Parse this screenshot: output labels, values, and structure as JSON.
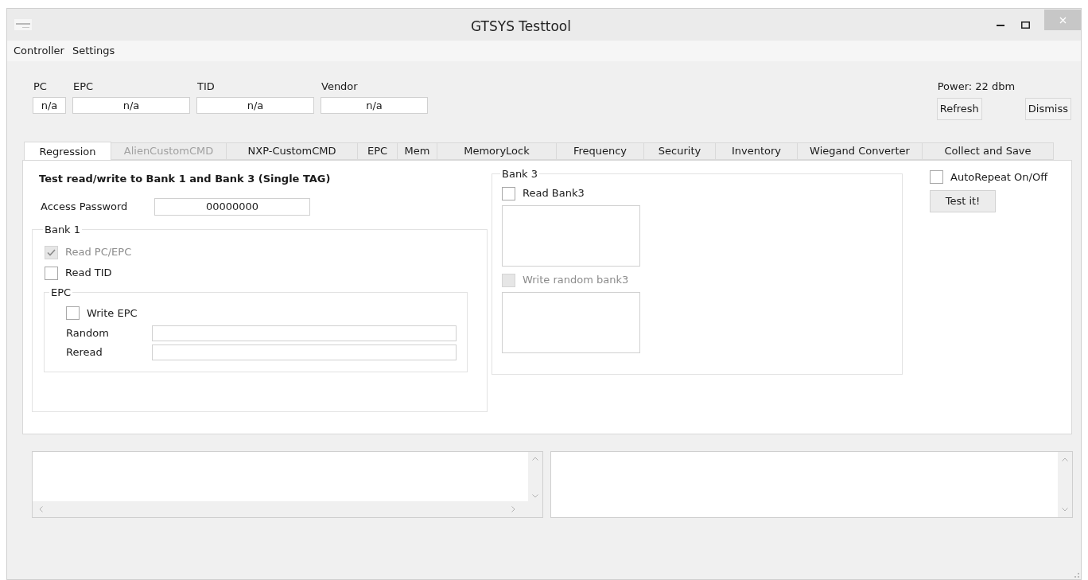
{
  "window": {
    "title": "GTSYS Testtool"
  },
  "menu": [
    "Controller",
    "Settings"
  ],
  "tag_fields": [
    {
      "label": "PC",
      "value": "n/a"
    },
    {
      "label": "EPC",
      "value": "n/a"
    },
    {
      "label": "TID",
      "value": "n/a"
    },
    {
      "label": "Vendor",
      "value": "n/a"
    }
  ],
  "power": "Power: 22 dbm",
  "header_buttons": [
    "Refresh",
    "Dismiss"
  ],
  "tabs": [
    {
      "label": "Regression",
      "selected": true,
      "disabled": false
    },
    {
      "label": "AlienCustomCMD",
      "selected": false,
      "disabled": true
    },
    {
      "label": "NXP-CustomCMD",
      "selected": false,
      "disabled": false
    },
    {
      "label": "EPC",
      "selected": false,
      "disabled": false
    },
    {
      "label": "Mem",
      "selected": false,
      "disabled": false
    },
    {
      "label": "MemoryLock",
      "selected": false,
      "disabled": false
    },
    {
      "label": "Frequency",
      "selected": false,
      "disabled": false
    },
    {
      "label": "Security",
      "selected": false,
      "disabled": false
    },
    {
      "label": "Inventory",
      "selected": false,
      "disabled": false
    },
    {
      "label": "Wiegand Converter",
      "selected": false,
      "disabled": false
    },
    {
      "label": "Collect and Save",
      "selected": false,
      "disabled": false
    }
  ],
  "regression": {
    "heading": "Test read/write to Bank 1 and  Bank 3 (Single TAG)",
    "access_password": {
      "label": "Access Password",
      "value": "00000000"
    },
    "bank1": {
      "title": "Bank 1",
      "checkboxes": [
        {
          "label": "Read PC/EPC",
          "checked": true,
          "disabled": true
        },
        {
          "label": "Read TID",
          "checked": false,
          "disabled": false
        }
      ],
      "epc": {
        "title": "EPC",
        "checkbox": {
          "label": "Write EPC",
          "checked": false,
          "disabled": false
        },
        "fields": [
          {
            "label": "Random"
          },
          {
            "label": "Reread"
          }
        ]
      }
    },
    "bank3": {
      "title": "Bank 3",
      "read": {
        "label": "Read Bank3",
        "checked": false,
        "disabled": false
      },
      "write": {
        "label": "Write random bank3",
        "checked": false,
        "disabled": true
      }
    },
    "auto_repeat": {
      "label": "AutoRepeat On/Off",
      "checked": false,
      "disabled": false
    },
    "test_button": "Test it!"
  },
  "logs": [
    {
      "kind": "both_scrollbars"
    },
    {
      "kind": "vertical_scrollbar"
    }
  ]
}
